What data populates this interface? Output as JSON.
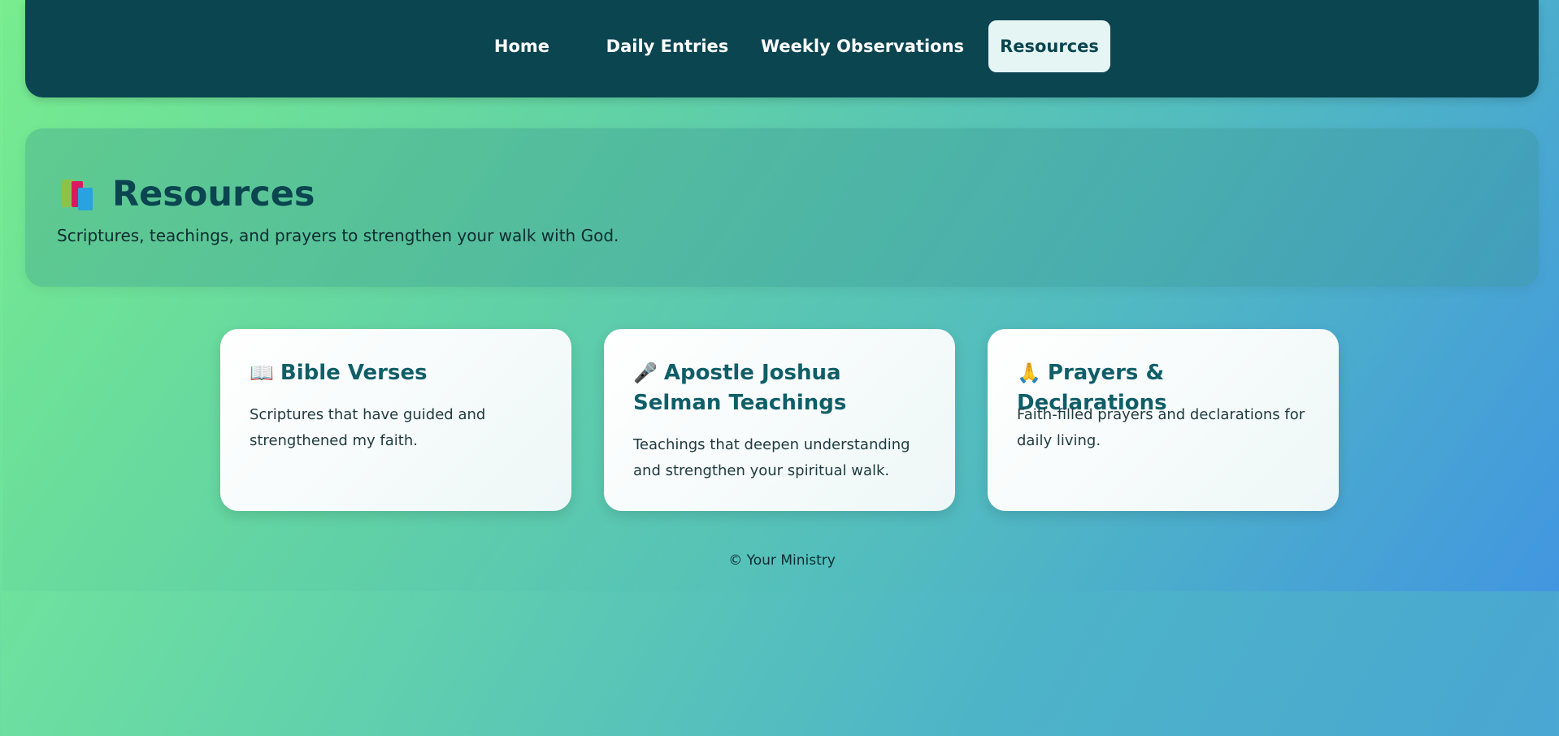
{
  "nav": {
    "items": [
      {
        "label": "Home",
        "active": false
      },
      {
        "label": "Daily Entries",
        "active": false
      },
      {
        "label": "Weekly Observations",
        "active": false
      },
      {
        "label": "Resources",
        "active": true
      }
    ]
  },
  "hero": {
    "icon": "books-icon",
    "title": "Resources",
    "subtitle": "Scriptures, teachings, and prayers to strengthen your walk with God."
  },
  "cards": [
    {
      "icon": "open-book-icon",
      "emoji": "📖",
      "title": "Bible Verses",
      "description": "Scriptures that have guided and strengthened my faith."
    },
    {
      "icon": "microphone-icon",
      "emoji": "🎤",
      "title": "Apostle Joshua Selman Teachings",
      "description": "Teachings that deepen understanding and strengthen your spiritual walk."
    },
    {
      "icon": "praying-hands-icon",
      "emoji": "🙏",
      "title": "Prayers & Declarations",
      "description": "Faith-filled prayers and declarations for daily living."
    }
  ],
  "footer": {
    "text": "© Your Ministry"
  },
  "colors": {
    "nav_bg": "#0a4550",
    "active_tab_bg": "#e4f5f4",
    "card_title": "#0f5e68"
  }
}
